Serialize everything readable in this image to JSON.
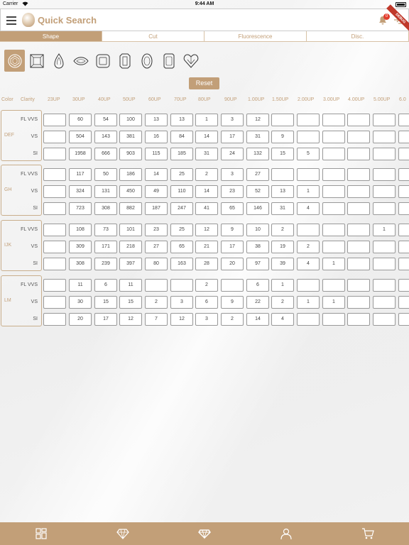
{
  "status_bar": {
    "carrier": "Carrier",
    "time": "9:44 AM",
    "battery": ""
  },
  "header": {
    "title": "Quick Search",
    "notification_count": "0",
    "debug_label": "DEBUG"
  },
  "tabs": [
    {
      "label": "Shape",
      "active": true
    },
    {
      "label": "Cut",
      "active": false
    },
    {
      "label": "Fluorescence",
      "active": false
    },
    {
      "label": "Disc.",
      "active": false
    }
  ],
  "shapes": [
    "round-icon",
    "princess-icon",
    "pear-icon",
    "marquise-icon",
    "cushion-icon",
    "emerald-icon",
    "oval-icon",
    "radiant-icon",
    "heart-icon"
  ],
  "reset_label": "Reset",
  "grid": {
    "color_header": "Color",
    "clarity_header": "Clarity",
    "columns": [
      "23UP",
      "30UP",
      "40UP",
      "50UP",
      "60UP",
      "70UP",
      "80UP",
      "90UP",
      "1.00UP",
      "1.50UP",
      "2.00UP",
      "3.00UP",
      "4.00UP",
      "5.00UP",
      "6.0"
    ],
    "groups": [
      {
        "color": "DEF",
        "rows": [
          {
            "clarity": "FL VVS",
            "values": [
              "",
              "60",
              "54",
              "100",
              "13",
              "13",
              "1",
              "3",
              "12",
              "",
              "",
              "",
              "",
              "",
              ""
            ]
          },
          {
            "clarity": "VS",
            "values": [
              "",
              "504",
              "143",
              "381",
              "16",
              "84",
              "14",
              "17",
              "31",
              "9",
              "",
              "",
              "",
              "",
              ""
            ]
          },
          {
            "clarity": "SI",
            "values": [
              "",
              "1958",
              "666",
              "903",
              "115",
              "185",
              "31",
              "24",
              "132",
              "15",
              "5",
              "",
              "",
              "",
              ""
            ]
          }
        ]
      },
      {
        "color": "GH",
        "rows": [
          {
            "clarity": "FL VVS",
            "values": [
              "",
              "117",
              "50",
              "186",
              "14",
              "25",
              "2",
              "3",
              "27",
              "",
              "",
              "",
              "",
              "",
              ""
            ]
          },
          {
            "clarity": "VS",
            "values": [
              "",
              "324",
              "131",
              "450",
              "49",
              "110",
              "14",
              "23",
              "52",
              "13",
              "1",
              "",
              "",
              "",
              ""
            ]
          },
          {
            "clarity": "SI",
            "values": [
              "",
              "723",
              "308",
              "882",
              "187",
              "247",
              "41",
              "65",
              "146",
              "31",
              "4",
              "",
              "",
              "",
              ""
            ]
          }
        ]
      },
      {
        "color": "IJK",
        "rows": [
          {
            "clarity": "FL VVS",
            "values": [
              "",
              "108",
              "73",
              "101",
              "23",
              "25",
              "12",
              "9",
              "10",
              "2",
              "",
              "",
              "",
              "1",
              ""
            ]
          },
          {
            "clarity": "VS",
            "values": [
              "",
              "309",
              "171",
              "218",
              "27",
              "65",
              "21",
              "17",
              "38",
              "19",
              "2",
              "",
              "",
              "",
              ""
            ]
          },
          {
            "clarity": "SI",
            "values": [
              "",
              "308",
              "239",
              "397",
              "80",
              "163",
              "28",
              "20",
              "97",
              "39",
              "4",
              "1",
              "",
              "",
              ""
            ]
          }
        ]
      },
      {
        "color": "LM",
        "rows": [
          {
            "clarity": "FL VVS",
            "values": [
              "",
              "11",
              "6",
              "11",
              "",
              "",
              "2",
              "",
              "6",
              "1",
              "",
              "",
              "",
              "",
              ""
            ]
          },
          {
            "clarity": "VS",
            "values": [
              "",
              "30",
              "15",
              "15",
              "2",
              "3",
              "6",
              "9",
              "22",
              "2",
              "1",
              "1",
              "",
              "",
              ""
            ]
          },
          {
            "clarity": "SI",
            "values": [
              "",
              "20",
              "17",
              "12",
              "7",
              "12",
              "3",
              "2",
              "14",
              "4",
              "",
              "",
              "",
              "",
              ""
            ]
          }
        ]
      }
    ]
  },
  "bottom_nav": [
    "dashboard-icon",
    "diamond-icon",
    "diamond-search-icon",
    "user-icon",
    "cart-icon"
  ],
  "colors": {
    "accent": "#c29f78",
    "badge": "#e23d2d"
  }
}
